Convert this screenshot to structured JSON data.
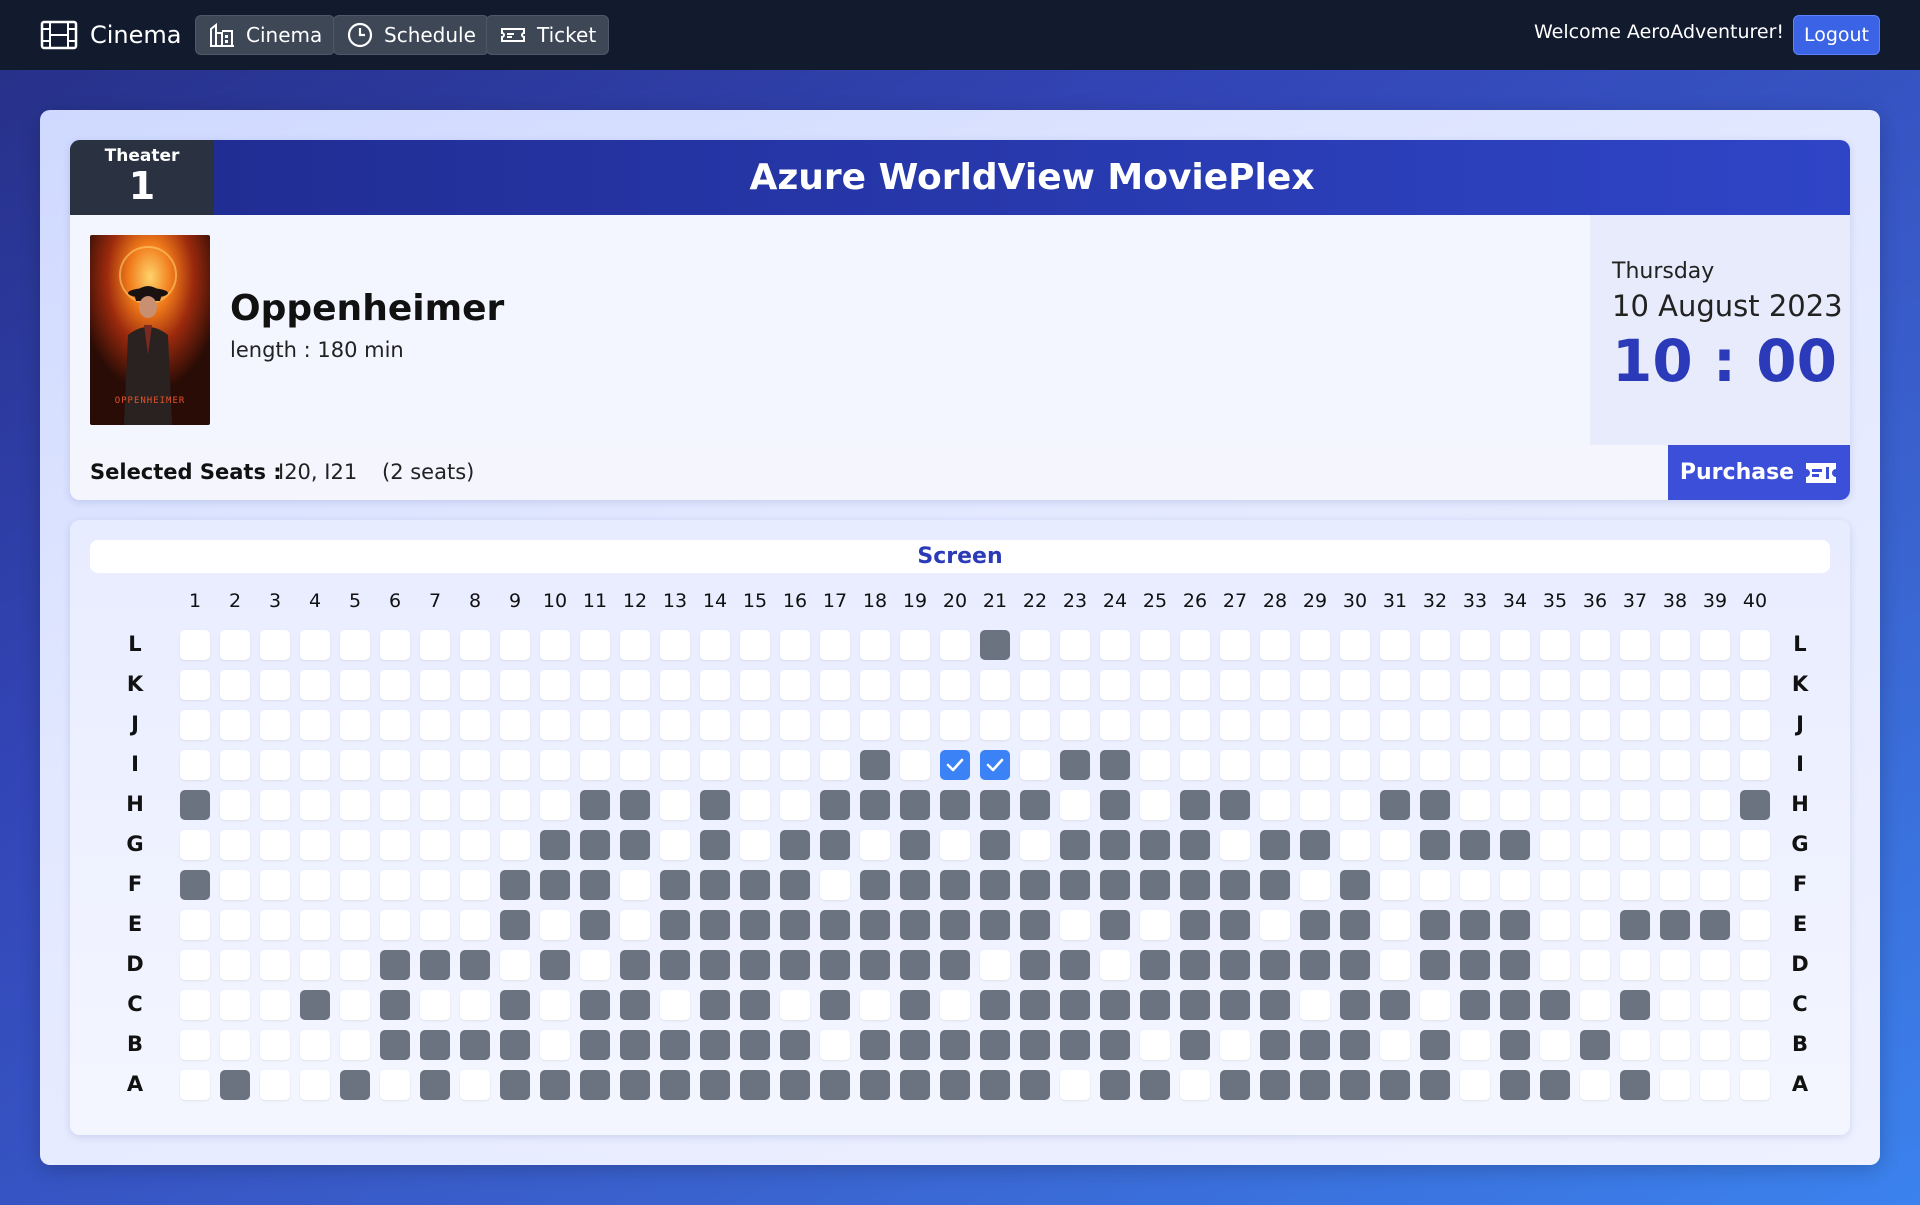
{
  "nav": {
    "brand": "Cinema",
    "cinema_label": "Cinema",
    "schedule_label": "Schedule",
    "ticket_label": "Ticket",
    "welcome": "Welcome AeroAdventurer!",
    "logout_label": "Logout"
  },
  "header": {
    "theater_label": "Theater",
    "theater_number": "1",
    "cinema_name": "Azure WorldView MoviePlex"
  },
  "movie": {
    "title": "Oppenheimer",
    "length": "length : 180 min",
    "poster_icon": "movie-poster-image"
  },
  "showtime": {
    "day": "Thursday",
    "date": "10 August 2023",
    "time": "10 : 00"
  },
  "selection": {
    "label": "Selected Seats :",
    "seats": "I20, I21",
    "count": "(2 seats)",
    "purchase_label": "Purchase"
  },
  "screen_label": "Screen",
  "colors": {
    "available": "#ffffff",
    "taken": "#6b7280",
    "selected": "#3b82f6",
    "accent": "#2b3ab8"
  },
  "seat_columns": 40,
  "seat_rows": [
    {
      "label": "L",
      "taken": [
        21
      ],
      "selected": []
    },
    {
      "label": "K",
      "taken": [],
      "selected": []
    },
    {
      "label": "J",
      "taken": [],
      "selected": []
    },
    {
      "label": "I",
      "taken": [
        18,
        23,
        24
      ],
      "selected": [
        20,
        21
      ]
    },
    {
      "label": "H",
      "taken": [
        1,
        11,
        12,
        14,
        17,
        18,
        19,
        20,
        21,
        22,
        24,
        26,
        27,
        31,
        32,
        40
      ],
      "selected": []
    },
    {
      "label": "G",
      "taken": [
        10,
        11,
        12,
        14,
        16,
        17,
        19,
        21,
        23,
        24,
        25,
        26,
        28,
        29,
        32,
        33,
        34
      ],
      "selected": []
    },
    {
      "label": "F",
      "taken": [
        1,
        9,
        10,
        11,
        13,
        14,
        15,
        16,
        18,
        19,
        20,
        21,
        22,
        23,
        24,
        25,
        26,
        27,
        28,
        30
      ],
      "selected": []
    },
    {
      "label": "E",
      "taken": [
        9,
        11,
        13,
        14,
        15,
        16,
        17,
        18,
        19,
        20,
        21,
        22,
        24,
        26,
        27,
        29,
        30,
        32,
        33,
        34,
        37,
        38,
        39
      ],
      "selected": []
    },
    {
      "label": "D",
      "taken": [
        6,
        7,
        8,
        10,
        12,
        13,
        14,
        15,
        16,
        17,
        18,
        19,
        20,
        22,
        23,
        25,
        26,
        27,
        28,
        29,
        30,
        32,
        33,
        34
      ],
      "selected": []
    },
    {
      "label": "C",
      "taken": [
        4,
        6,
        9,
        11,
        12,
        14,
        15,
        17,
        19,
        21,
        22,
        23,
        24,
        25,
        26,
        27,
        28,
        30,
        31,
        33,
        34,
        35,
        37
      ],
      "selected": []
    },
    {
      "label": "B",
      "taken": [
        6,
        7,
        8,
        9,
        11,
        12,
        13,
        14,
        15,
        16,
        18,
        19,
        20,
        21,
        22,
        23,
        24,
        26,
        28,
        29,
        30,
        32,
        34,
        36
      ],
      "selected": []
    },
    {
      "label": "A",
      "taken": [
        2,
        5,
        7,
        9,
        10,
        11,
        12,
        13,
        14,
        15,
        16,
        17,
        18,
        19,
        20,
        21,
        22,
        24,
        25,
        27,
        28,
        29,
        30,
        31,
        32,
        34,
        35,
        37
      ],
      "selected": []
    }
  ]
}
